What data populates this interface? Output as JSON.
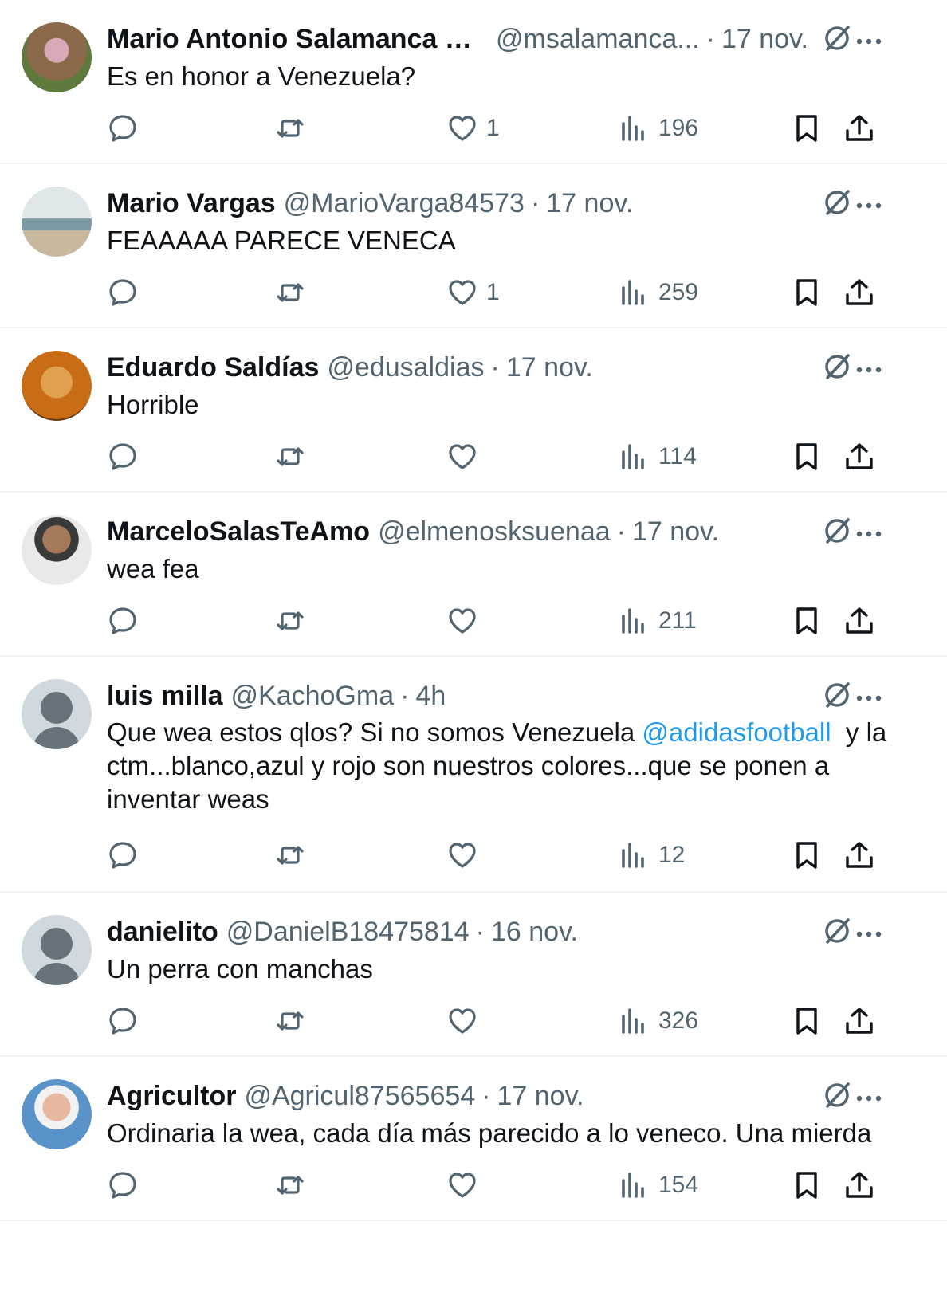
{
  "tweets": [
    {
      "name": "Mario Antonio Salamanca C...",
      "handle": "@msalamanca...",
      "time": "17 nov.",
      "text": "Es en honor a Venezuela?",
      "likes": "1",
      "views": "196",
      "avatar_color": "#8a6a4a"
    },
    {
      "name": "Mario Vargas",
      "handle": "@MarioVarga84573",
      "time": "17 nov.",
      "text": "FEAAAAA PARECE VENECA",
      "likes": "1",
      "views": "259",
      "avatar_color": "#b9c6c9"
    },
    {
      "name": "Eduardo Saldías",
      "handle": "@edusaldias",
      "time": "17 nov.",
      "text": "Horrible",
      "likes": "",
      "views": "114",
      "avatar_color": "#d07a1c"
    },
    {
      "name": "MarceloSalasTeAmo",
      "handle": "@elmenosksuenaa",
      "time": "17 nov.",
      "text": "wea fea",
      "likes": "",
      "views": "211",
      "avatar_color": "#7a5d4a"
    },
    {
      "name": "luis milla",
      "handle": "@KachoGma",
      "time": "4h",
      "text_before": "Que wea estos qlos? Si no somos Venezuela ",
      "mention": "@adidasfootball",
      "text_after": "  y la ctm...blanco,azul y rojo son nuestros colores...que se ponen a inventar weas",
      "likes": "",
      "views": "12",
      "avatar_color": "#cfd9de"
    },
    {
      "name": "danielito",
      "handle": "@DanielB18475814",
      "time": "16 nov.",
      "text": "Un perra con manchas",
      "likes": "",
      "views": "326",
      "avatar_color": "#cfd9de"
    },
    {
      "name": "Agricultor",
      "handle": "@Agricul87565654",
      "time": "17 nov.",
      "text": "Ordinaria la wea, cada día más parecido a lo veneco. Una mierda",
      "likes": "",
      "views": "154",
      "avatar_color": "#5a93c9"
    }
  ],
  "colors": {
    "text_primary": "#0f1419",
    "text_secondary": "#536471",
    "link": "#1d9bf0",
    "divider": "#eff3f4"
  },
  "icons": {
    "grok": "grok-icon",
    "more": "more-icon",
    "reply": "reply-icon",
    "retweet": "retweet-icon",
    "like": "heart-icon",
    "views": "views-icon",
    "bookmark": "bookmark-icon",
    "share": "share-icon"
  }
}
